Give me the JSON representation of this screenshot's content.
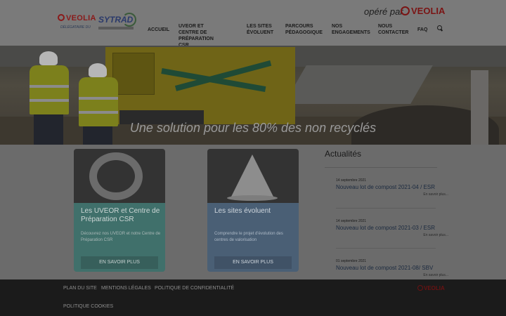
{
  "header": {
    "logo_brand": "VEOLIA",
    "logo_delegataire": "DÉLÉGATAIRE DU",
    "logo_sytrad": "SYTRAD",
    "operated_label": "opéré par",
    "operated_brand": "VEOLIA"
  },
  "nav": [
    {
      "label": "ACCUEIL"
    },
    {
      "label": "UVEOR ET CENTRE DE\nPRÉPARATION CSR"
    },
    {
      "label": "LES SITES\nÉVOLUENT"
    },
    {
      "label": "PARCOURS\nPÉDAGOGIQUE"
    },
    {
      "label": "NOS\nENGAGEMENTS"
    },
    {
      "label": "NOUS\nCONTACTER"
    },
    {
      "label": "FAQ"
    }
  ],
  "hero": {
    "caption": "Une solution pour les 80% des non recyclés"
  },
  "cards": [
    {
      "title": "Les UVEOR et Centre de Préparation CSR",
      "description": "Découvrez nos UVEOR et notre Centre de Préparation CSR",
      "button": "EN SAVOIR PLUS"
    },
    {
      "title": "Les sites évoluent",
      "description": "Comprendre le projet d'évolution des centres de valorisation",
      "button": "EN SAVOIR PLUS"
    }
  ],
  "news": {
    "title": "Actualités",
    "items": [
      {
        "date": "14 septembre 2021",
        "headline": "Nouveau lot de compost 2021-04 / ESR",
        "more": "En savoir plus..."
      },
      {
        "date": "14 septembre 2021",
        "headline": "Nouveau lot de compost 2021-03 / ESR",
        "more": "En savoir plus..."
      },
      {
        "date": "01 septembre 2021",
        "headline": "Nouveau lot de compost 2021-08/ SBV",
        "more": "En savoir plus..."
      }
    ]
  },
  "footer": {
    "links": [
      {
        "label": "PLAN DU SITE"
      },
      {
        "label": "MENTIONS LÉGALES"
      },
      {
        "label": "POLITIQUE DE CONFIDENTIALITÉ"
      },
      {
        "label": "POLITIQUE COOKIES"
      }
    ],
    "brand": "VEOLIA"
  },
  "colors": {
    "brand_red": "#d2232a",
    "card_teal": "#40706b",
    "card_blue": "#4a5f75",
    "footer_bg": "#1b1b1b"
  },
  "icons": {
    "search": "search-icon"
  }
}
